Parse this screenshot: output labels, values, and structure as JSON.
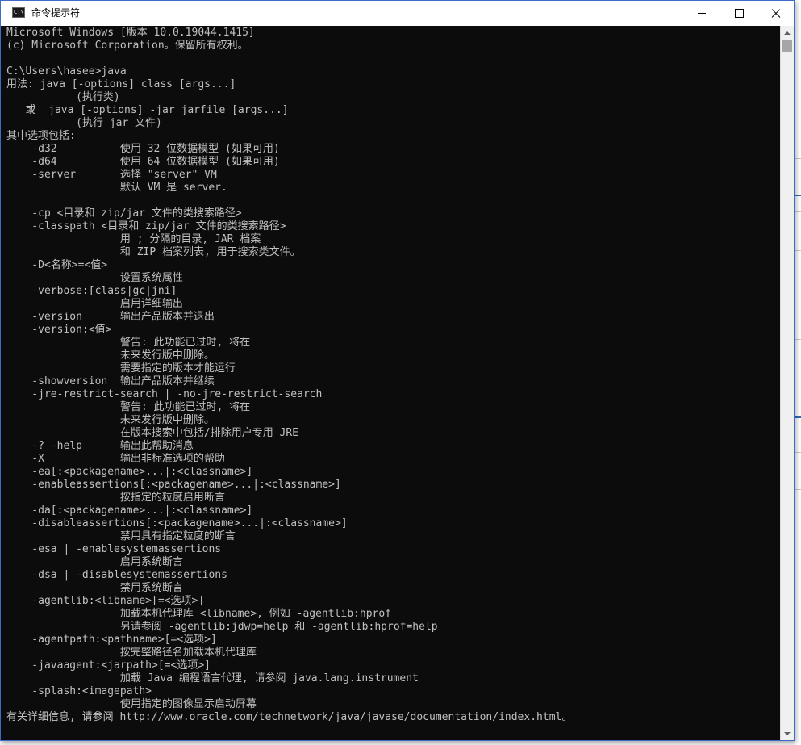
{
  "window": {
    "title": "命令提示符",
    "icon_text": "C:\\.",
    "icon": "console-app-icon",
    "controls": [
      "minimize-icon",
      "maximize-icon",
      "close-icon"
    ]
  },
  "colors": {
    "console_bg": "#0c0c0c",
    "console_fg": "#c0c0c0",
    "titlebar_bg": "#ffffff"
  },
  "console": {
    "lines": [
      "Microsoft Windows [版本 10.0.19044.1415]",
      "(c) Microsoft Corporation。保留所有权利。",
      "",
      "C:\\Users\\hasee>java",
      "用法: java [-options] class [args...]",
      "           (执行类)",
      "   或  java [-options] -jar jarfile [args...]",
      "           (执行 jar 文件)",
      "其中选项包括:",
      "    -d32          使用 32 位数据模型 (如果可用)",
      "    -d64          使用 64 位数据模型 (如果可用)",
      "    -server       选择 \"server\" VM",
      "                  默认 VM 是 server.",
      "",
      "    -cp <目录和 zip/jar 文件的类搜索路径>",
      "    -classpath <目录和 zip/jar 文件的类搜索路径>",
      "                  用 ; 分隔的目录, JAR 档案",
      "                  和 ZIP 档案列表, 用于搜索类文件。",
      "    -D<名称>=<值>",
      "                  设置系统属性",
      "    -verbose:[class|gc|jni]",
      "                  启用详细输出",
      "    -version      输出产品版本并退出",
      "    -version:<值>",
      "                  警告: 此功能已过时, 将在",
      "                  未来发行版中删除。",
      "                  需要指定的版本才能运行",
      "    -showversion  输出产品版本并继续",
      "    -jre-restrict-search | -no-jre-restrict-search",
      "                  警告: 此功能已过时, 将在",
      "                  未来发行版中删除。",
      "                  在版本搜索中包括/排除用户专用 JRE",
      "    -? -help      输出此帮助消息",
      "    -X            输出非标准选项的帮助",
      "    -ea[:<packagename>...|:<classname>]",
      "    -enableassertions[:<packagename>...|:<classname>]",
      "                  按指定的粒度启用断言",
      "    -da[:<packagename>...|:<classname>]",
      "    -disableassertions[:<packagename>...|:<classname>]",
      "                  禁用具有指定粒度的断言",
      "    -esa | -enablesystemassertions",
      "                  启用系统断言",
      "    -dsa | -disablesystemassertions",
      "                  禁用系统断言",
      "    -agentlib:<libname>[=<选项>]",
      "                  加载本机代理库 <libname>, 例如 -agentlib:hprof",
      "                  另请参阅 -agentlib:jdwp=help 和 -agentlib:hprof=help",
      "    -agentpath:<pathname>[=<选项>]",
      "                  按完整路径名加载本机代理库",
      "    -javaagent:<jarpath>[=<选项>]",
      "                  加载 Java 编程语言代理, 请参阅 java.lang.instrument",
      "    -splash:<imagepath>",
      "                  使用指定的图像显示启动屏幕",
      "有关详细信息, 请参阅 http://www.oracle.com/technetwork/java/javase/documentation/index.html。"
    ]
  }
}
